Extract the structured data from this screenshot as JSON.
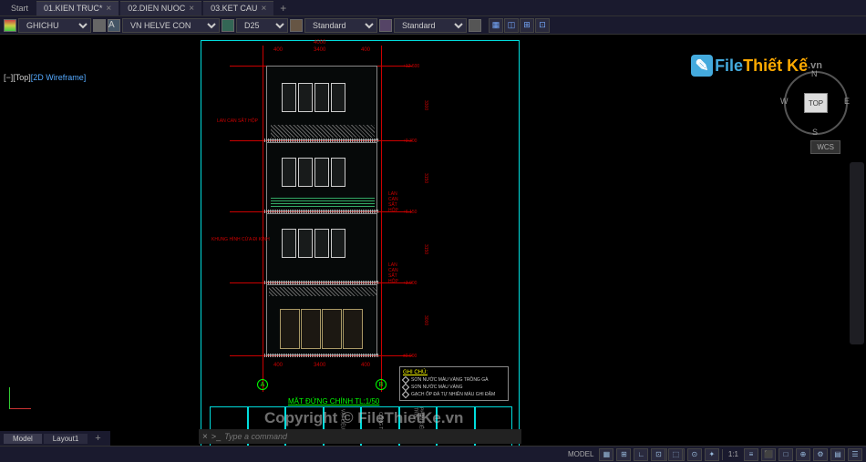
{
  "tabs": {
    "start": "Start",
    "items": [
      {
        "label": "01.KIEN TRUC*",
        "active": true
      },
      {
        "label": "02.DIEN NUOC",
        "active": false
      },
      {
        "label": "03.KET CAU",
        "active": false
      }
    ],
    "add": "+"
  },
  "properties": {
    "layer": "GHICHU",
    "textstyle": "VN HELVE CON",
    "dimstyle": "D25",
    "tablestyle1": "Standard",
    "tablestyle2": "Standard"
  },
  "viewport": {
    "controls": "[−][Top]",
    "style": "[2D Wireframe]"
  },
  "viewcube": {
    "face": "TOP",
    "n": "N",
    "s": "S",
    "e": "E",
    "w": "W",
    "wcs": "WCS"
  },
  "logo": {
    "file": "File",
    "thiet": "Thiết Kế",
    "vn": ".vn"
  },
  "drawing": {
    "title": "MẶT ĐỨNG CHÍNH TL:1/50",
    "axis_a": "A",
    "axis_b": "B",
    "dims_top": [
      "400",
      "3400",
      "400"
    ],
    "dim_overall": "4000",
    "annot_left": "KHUNG HÌNH CỬA ĐI KÍNH",
    "annot_lancan": "LAN CAN SẮT HỘP",
    "levels": [
      "+12.600",
      "+9.300",
      "+6.150",
      "+3.000",
      "±0.000"
    ],
    "floor_h": [
      "3300",
      "3150",
      "3150",
      "3000"
    ],
    "notes_title": "GHI CHÚ:",
    "notes": [
      "SƠN NƯỚC MÀU VÀNG TRỒNG GÀ",
      "SƠN NƯỚC MÀU VÀNG",
      "GẠCH ỐP ĐÁ TỰ NHIÊN MÀU GHI ĐẬM"
    ],
    "tb_labels": [
      "",
      "",
      "",
      "VẬT LIỆU HOÀN",
      "CÔNG TRÌNH",
      "PHẦN KIẾN TRÚC",
      "",
      ""
    ]
  },
  "command": {
    "history": "×",
    "prompt": ">_",
    "placeholder": "Type a command"
  },
  "bottom_tabs": {
    "items": [
      "Model",
      "Layout1"
    ],
    "active": "Model",
    "add": "+"
  },
  "status": {
    "model": "MODEL",
    "scale": "1:1",
    "icons": [
      "▦",
      "⊞",
      "┼",
      "∟",
      "⊡",
      "⬚",
      "◫",
      "⊙",
      "✦",
      "≡",
      "⬛",
      "□",
      "⊕",
      "⚙",
      "▤",
      "☰"
    ]
  },
  "watermark": "Copyright © FileThietKe.vn"
}
